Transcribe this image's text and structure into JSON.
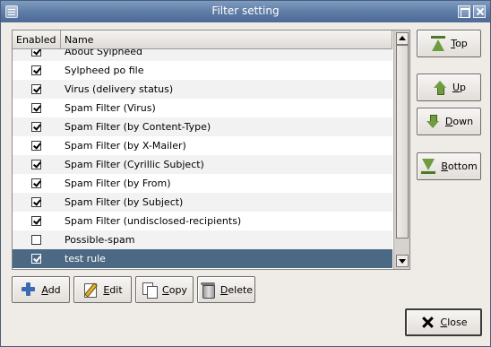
{
  "window": {
    "title": "Filter setting"
  },
  "list": {
    "columns": {
      "enabled": "Enabled",
      "name": "Name"
    },
    "rows": [
      {
        "enabled": true,
        "name": "About Sylpheed",
        "selected": false
      },
      {
        "enabled": true,
        "name": "Sylpheed po file",
        "selected": false
      },
      {
        "enabled": true,
        "name": "Virus (delivery status)",
        "selected": false
      },
      {
        "enabled": true,
        "name": "Spam Filter (Virus)",
        "selected": false
      },
      {
        "enabled": true,
        "name": "Spam Filter (by Content-Type)",
        "selected": false
      },
      {
        "enabled": true,
        "name": "Spam Filter (by X-Mailer)",
        "selected": false
      },
      {
        "enabled": true,
        "name": "Spam Filter (Cyrillic Subject)",
        "selected": false
      },
      {
        "enabled": true,
        "name": "Spam Filter (by From)",
        "selected": false
      },
      {
        "enabled": true,
        "name": "Spam Filter (by Subject)",
        "selected": false
      },
      {
        "enabled": true,
        "name": "Spam Filter (undisclosed-recipients)",
        "selected": false
      },
      {
        "enabled": false,
        "name": "Possible-spam",
        "selected": false
      },
      {
        "enabled": true,
        "name": "test rule",
        "selected": true
      }
    ]
  },
  "move_buttons": {
    "top": {
      "mnemonic": "T",
      "rest": "op"
    },
    "up": {
      "mnemonic": "U",
      "rest": "p"
    },
    "down": {
      "mnemonic": "D",
      "rest": "own"
    },
    "bottom": {
      "mnemonic": "B",
      "rest": "ottom"
    }
  },
  "action_buttons": {
    "add": {
      "mnemonic": "A",
      "rest": "dd"
    },
    "edit": {
      "mnemonic": "E",
      "rest": "dit"
    },
    "copy": {
      "mnemonic": "C",
      "rest": "opy"
    },
    "delete": {
      "mnemonic": "D",
      "rest": "elete"
    }
  },
  "close_button": {
    "mnemonic": "C",
    "rest": "lose"
  },
  "colors": {
    "titlebar": "#5c7aa4",
    "selection": "#4b6983",
    "window_bg": "#efebe7"
  }
}
